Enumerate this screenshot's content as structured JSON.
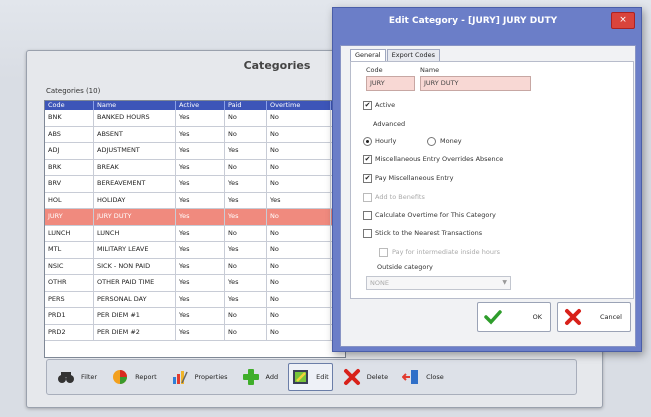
{
  "categories_window": {
    "title": "Categories",
    "count_label": "Categories (10)",
    "columns": [
      "Code",
      "Name",
      "Active",
      "Paid",
      "Overtime"
    ],
    "rows": [
      [
        "BNK",
        "BANKED HOURS",
        "Yes",
        "No",
        "No"
      ],
      [
        "ABS",
        "ABSENT",
        "Yes",
        "No",
        "No"
      ],
      [
        "ADJ",
        "ADJUSTMENT",
        "Yes",
        "Yes",
        "No"
      ],
      [
        "BRK",
        "BREAK",
        "Yes",
        "No",
        "No"
      ],
      [
        "BRV",
        "BEREAVEMENT",
        "Yes",
        "Yes",
        "No"
      ],
      [
        "HOL",
        "HOLIDAY",
        "Yes",
        "Yes",
        "Yes"
      ],
      [
        "JURY",
        "JURY DUTY",
        "Yes",
        "Yes",
        "No"
      ],
      [
        "LUNCH",
        "LUNCH",
        "Yes",
        "No",
        "No"
      ],
      [
        "MTL",
        "MILITARY LEAVE",
        "Yes",
        "Yes",
        "No"
      ],
      [
        "NSIC",
        "SICK - NON PAID",
        "Yes",
        "No",
        "No"
      ],
      [
        "OTHR",
        "OTHER PAID TIME",
        "Yes",
        "Yes",
        "No"
      ],
      [
        "PERS",
        "PERSONAL DAY",
        "Yes",
        "Yes",
        "No"
      ],
      [
        "PRD1",
        "PER DIEM #1",
        "Yes",
        "No",
        "No"
      ],
      [
        "PRD2",
        "PER DIEM #2",
        "Yes",
        "No",
        "No"
      ]
    ],
    "selected_row_index": 6,
    "toolbar": {
      "filter": "Filter",
      "report": "Report",
      "properties": "Properties",
      "add": "Add",
      "edit": "Edit",
      "delete": "Delete",
      "close": "Close"
    }
  },
  "edit_dialog": {
    "title": "Edit Category - [JURY] JURY DUTY",
    "close_glyph": "×",
    "tabs": [
      "General",
      "Export Codes"
    ],
    "code_label": "Code",
    "code_value": "JURY",
    "name_label": "Name",
    "name_value": "JURY DUTY",
    "active_label": "Active",
    "advanced_label": "Advanced",
    "hourly_label": "Hourly",
    "money_label": "Money",
    "misc_override_label": "Miscellaneous Entry Overrides Absence",
    "pay_misc_label": "Pay Miscellaneous Entry",
    "add_benefits_label": "Add to Benefits",
    "calc_overtime_label": "Calculate Overtime for This Category",
    "stick_nearest_label": "Stick to the Nearest Transactions",
    "pay_intermediate_label": "Pay for intermediate inside hours",
    "outside_category_label": "Outside category",
    "outside_category_value": "NONE",
    "ok_label": "OK",
    "cancel_label": "Cancel",
    "check_glyph": "✔"
  },
  "colors": {
    "grid_header": "#3d55b8",
    "selected_row": "#f08a7e",
    "dialog_frame": "#6b7ec8",
    "close_button": "#d9443c",
    "field_bg": "#f8d8d4"
  }
}
